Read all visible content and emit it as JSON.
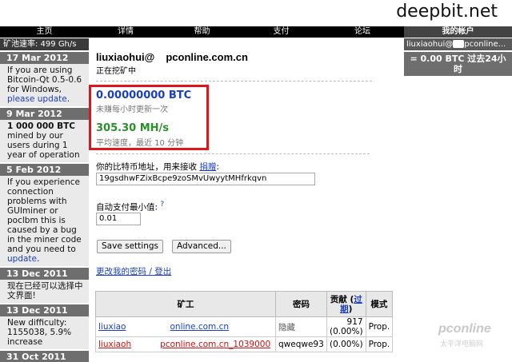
{
  "site": {
    "title": "deepbit.net"
  },
  "nav": [
    {
      "label": "主页",
      "width": 111
    },
    {
      "label": "详情",
      "width": 92
    },
    {
      "label": "帮助",
      "width": 99
    },
    {
      "label": "支付",
      "width": 99
    },
    {
      "label": "论坛",
      "width": 104
    },
    {
      "label": "我的帐户",
      "width": 135,
      "active": true
    }
  ],
  "left": {
    "pool_speed": "矿池速率: 499 Gh/s",
    "news": [
      {
        "date": "17 Mar 2012",
        "text": "If you are using Bitcoin-Qt 0.5-0.6 for Windows, ",
        "link": "please update",
        "tail": "."
      },
      {
        "date": "9 Mar 2012",
        "bold": "1 000 000 BTC",
        "text": " mined by our users during 1 year of operation"
      },
      {
        "date": "5 Feb 2012",
        "text": "If you experience connection problems with GUIminer or poclbm this is caused by a bug in the miner code and you need to ",
        "link": "update",
        "tail": "."
      },
      {
        "date": "13 Dec 2011",
        "text": "现在已经可以选择中文界面!"
      },
      {
        "date": "13 Dec 2011",
        "text": "New difficulty: 1155038, 5.9% increase"
      },
      {
        "date": "31 Oct 2011",
        "text": ""
      }
    ]
  },
  "right": {
    "account_user": "liuxiaohui@",
    "account_domain": "pconline...",
    "stat": "= 0.00 BTC 过去24小时"
  },
  "main": {
    "user": "liuxiaohui@",
    "domain": "pconline.com.cn",
    "status": "正在挖矿中",
    "btc": "0.00000000 BTC",
    "btc_note": "未赚每小时更新一次",
    "hashrate": "305.30 MH/s",
    "hashrate_note": "平均速度，最近 10 分钟",
    "addr_label": "你的比特币地址，用来接收 ",
    "addr_link": "捐赠",
    "addr_colon": ":",
    "addr_value": "19gsdhwFZixBcpe9zoSMvUwyytMHfrkqvn",
    "min_label": "自动支付最小值:",
    "min_q": "?",
    "min_value": "0.01",
    "save_btn": "Save settings",
    "adv_btn": "Advanced...",
    "pw_link": "更改我的密码 / 登出"
  },
  "workers": {
    "headers": [
      "矿工",
      "密码",
      "贡献 (",
      "过期",
      ")",
      "模式"
    ],
    "rows": [
      {
        "name1": "liuxiao",
        "name2": "online.com.cn",
        "password": "隐藏",
        "contrib": "917",
        "pct": "(0.00%)",
        "mode": "Prop."
      },
      {
        "name1": "liuxiaoh",
        "name2": "pconline.com.cn_1039000",
        "password": "qweqwe93",
        "contrib": "",
        "pct": "(0.00%)",
        "mode": "Prop."
      }
    ]
  },
  "watermark": {
    "brand": "pconline",
    "sub": "太平洋电脑网"
  },
  "colors": {
    "highlight": "#e0141c",
    "link": "#1a3fbf",
    "hash": "#2a8f2a",
    "worker_red": "#cc1111"
  }
}
